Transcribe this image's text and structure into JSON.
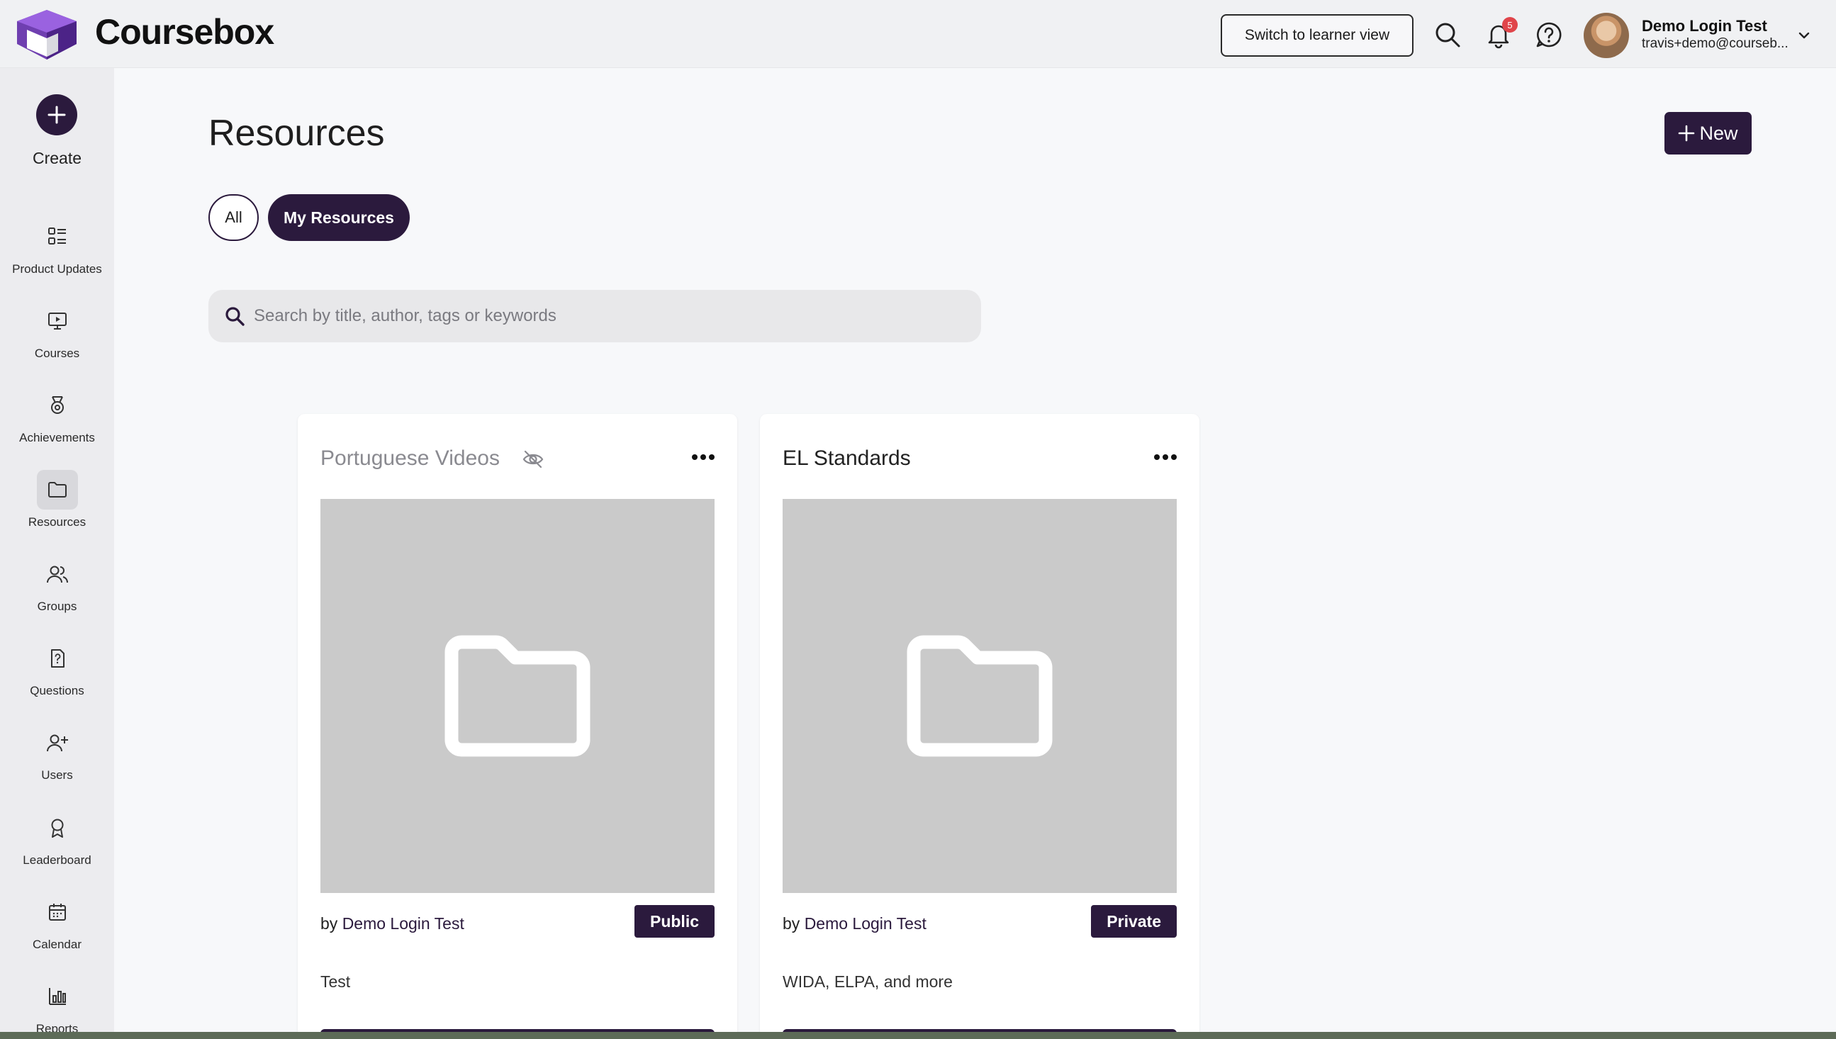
{
  "app": {
    "brand": "Coursebox",
    "brand_color": "#2b1a3d"
  },
  "header": {
    "learner_view_label": "Switch to learner view",
    "notification_count": "5",
    "user_name": "Demo Login Test",
    "user_email": "travis+demo@courseb..."
  },
  "sidebar": {
    "create_label": "Create",
    "items": [
      {
        "label": "Product Updates",
        "icon": "grid-list-icon"
      },
      {
        "label": "Courses",
        "icon": "monitor-play-icon"
      },
      {
        "label": "Achievements",
        "icon": "medal-icon"
      },
      {
        "label": "Resources",
        "icon": "folder-icon"
      },
      {
        "label": "Groups",
        "icon": "users-icon"
      },
      {
        "label": "Questions",
        "icon": "question-file-icon"
      },
      {
        "label": "Users",
        "icon": "user-plus-icon"
      },
      {
        "label": "Leaderboard",
        "icon": "award-icon"
      },
      {
        "label": "Calendar",
        "icon": "calendar-icon"
      },
      {
        "label": "Reports",
        "icon": "bar-chart-icon"
      }
    ],
    "active_item": "Resources"
  },
  "main": {
    "title": "Resources",
    "new_label": "New",
    "filters": [
      {
        "label": "All",
        "selected": false
      },
      {
        "label": "My Resources",
        "selected": true
      }
    ],
    "search_placeholder": "Search by title, author, tags or keywords"
  },
  "cards": [
    {
      "title": "Portuguese Videos",
      "hidden": true,
      "author_prefix": "by",
      "author": "Demo Login Test",
      "visibility": "Public",
      "description": "Test"
    },
    {
      "title": "EL Standards",
      "hidden": false,
      "author_prefix": "by",
      "author": "Demo Login Test",
      "visibility": "Private",
      "description": "WIDA, ELPA, and more"
    }
  ]
}
